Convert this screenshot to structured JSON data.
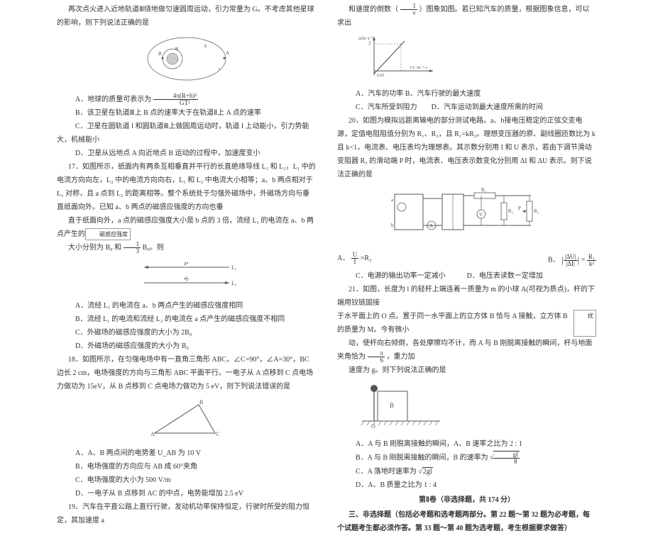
{
  "left": {
    "q16_intro": "再次点火进入近地轨道Ⅲ绕地做匀速圆周运动，引力常量为 G。不考虑其他星球的影响，则下列说法正确的是",
    "q16_A_pre": "A．地球的质量可表示为 ",
    "q16_A_frac_n": "4π(R+h)³",
    "q16_A_frac_d": "GT²",
    "q16_B": "B．该卫星在轨道Ⅲ上 B 点的速率大于在轨道Ⅱ上 A 点的速率",
    "q16_C": "C．卫星在圆轨道 Ⅰ 和圆轨道Ⅲ上做圆周运动时，轨道 Ⅰ 上动能小，引力势能大，机械能小",
    "q16_D": "D．卫星从远地点 A 向近地点 B 运动的过程中，加速度变小",
    "q17_p1": "17．如图所示，纸面内有两条互相垂直并平行的长直绝缘导线 L₁ 和 L₂，L₁ 中的电流方向向左，L₂ 中的电流方向向右，L₁ 和 L₂ 中电流大小相等；a、b 两点相对于 L₁ 对称，且 a 点到 L₂ 的距离相等。整个系统处于匀强外磁场中，外磁场方向与垂直纸面向外。已知 a、b 两点的磁感应强度的方向也垂",
    "q17_p2_pre": "直于纸面向外，a 点的磁感应强度大小是 b 点的 3 倍，流经 L₁ 的电流在 a、b 两点产生的",
    "q17_p2_mid": "磁感应强度",
    "q17_p3_pre": "大小分别为 B₀ 和",
    "q17_frac_n": "1",
    "q17_frac_d": "3",
    "q17_p3_post": "B₀。则",
    "q17_L1": "a•",
    "q17_L1r": "L₁",
    "q17_L2": "•b",
    "q17_L2r": "L₂",
    "q17_A": "A．流经 L₁ 的电流在 a、b 两点产生的磁感应强度相同",
    "q17_B": "B．流经 L₁ 的电流和流经 L₂ 的电流在 a 点产生的磁感应强度不相同",
    "q17_C": "C．外磁场的磁感应强度的大小为 2B₀",
    "q17_D": "D．外磁场的磁感应强度的大小为 B₀",
    "q18_p1": "18．如图所示，在匀强电场中有一直角三角形 ABC，∠C=90°，∠A=30°，BC边长 2 cm，电场强度的方向与三角形 ABC 平面平行。一电子从 A 点移到 C 点电场力做功为 15eV，从 B 点移到 C 点电场力做功为 5 eV，则下列说法错误的是",
    "q18_A": "A．A、B 两点间的电势差 U_AB 为 10 V",
    "q18_B": "B．电场强度的方向应与 AB 成 60°夹角",
    "q18_C": "C．电场强度的大小为 500 V/m",
    "q18_D": "D．一电子从 B 点移到 AC 的中点，电势能增加 2.5 eV",
    "q19_p1": "19．汽车在平直公路上直行行驶，发动机功率保持恒定，行驶时所受的阻力恒定，其加速度 a"
  },
  "right": {
    "q19_p2_pre": "和速度的倒数（",
    "q19_frac_n": "1",
    "q19_frac_d": "v",
    "q19_p2_post": "）图象如图。若已知汽车的质量，根据图象信息，可以求出",
    "q19_axA": "a/m·s⁻²",
    "q19_axB": "2",
    "q19_axC": "0.05",
    "q19_axD": "1/v /m⁻¹·s",
    "q19_AB": "A．汽车的功率 B．汽车行驶的最大速度",
    "q19_CD": "C．汽车所受到阻力　　D．汽车运动到最大速度所需的时间",
    "q20_p1": "20．如图为模拟远距离输电的部分测试电路。a、b接电压稳定的正弦交变电源，定值电阻阻值分别为 R₁、R₂，且 R₁=kR₂。理想变压器的原、副线圈匝数比为 k 且 k<1，电流表、电压表均为理想表。其示数分别用 I 和 U 表示，若由下调节滑动变阻器 R₃ 的滑动端 P 时，电流表、电压表示数变化分别用 ΔI 和 ΔU 表示。则下说法正确的是",
    "q20_A_pre": "A．",
    "q20_A_Uf_n": "U",
    "q20_A_Uf_d": "I",
    "q20_A_post": "=R₂",
    "q20_B_pre": "B．",
    "q20_B_lhs_n": "|ΔU|",
    "q20_B_lhs_d": "|ΔI|",
    "q20_B_mid": "=",
    "q20_B_rhs_n": "R₁",
    "q20_B_rhs_d": "k²",
    "q20_C": "C．电源的输出功率一定减小　　　D．电压表读数一定增加",
    "q21_p1_pre": "21．如图，长度为 l 的轻杆上端连着一质量为 m 的小球 A(可视为质点)，杆的下端用铰链固接",
    "q21_p1_mid": "于水平面上的 O 点。置于同一水平面上的立方体 B 恰与 A 接触，立方体 B 的质量为 M。今有微小",
    "q21_p1_side": "扰",
    "q21_p2_pre": "动，使杆向右倾倒，各处摩擦均不计，而 A 与 B 刚脱离接触的瞬间，杆与地面夹角恰为",
    "q21_p2_frac_n": "π",
    "q21_p2_frac_d": "6",
    "q21_p2_post": "，重力加",
    "q21_p3": "速度为 g。则下列说法正确的是",
    "q21_B": "B",
    "q21_O": "O",
    "q21_A": "A．A 与 B 刚脱离接触的瞬间，A、B 速率之比为 2 : 1",
    "q21_Bopt_pre": "B．A 与 B 刚脱离接触的瞬间，B 的速率为",
    "q21_Bopt_n": "gl",
    "q21_Bopt_d": "8",
    "q21_Copt_pre": "C．A 落地时速率为 ",
    "q21_Copt_rt": "2gl",
    "q21_D": "D．A、B 质量之比为 1 : 4",
    "sec2_title": "第Ⅱ卷（非选择题，共 174 分）",
    "sec2_p1": "三、非选择题（包括必考题和选考题两部分。第 22 题～第 32 题为必考题，每个试题考生都必须作答。第 33 题～第 40 题为选考题，考生根据要求做答）"
  }
}
